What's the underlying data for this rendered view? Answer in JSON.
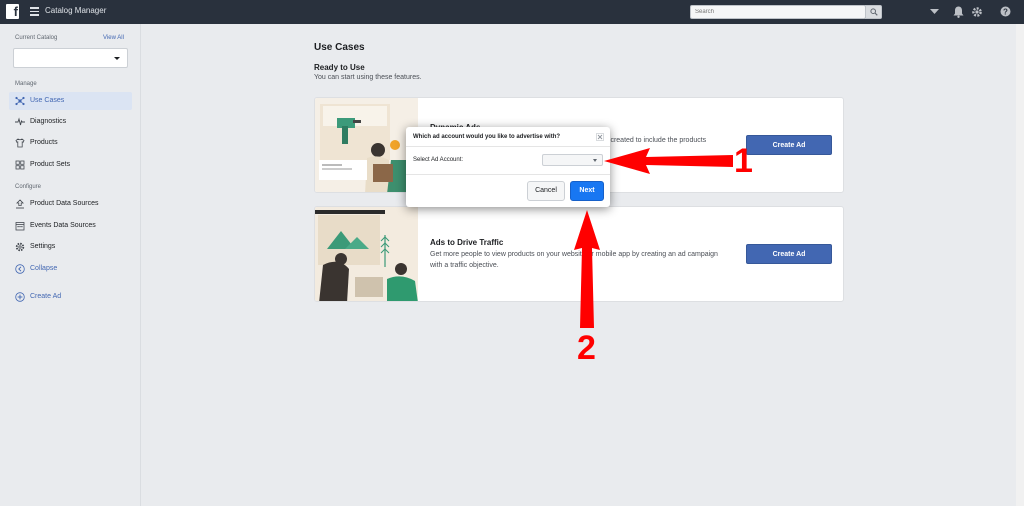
{
  "topbar": {
    "app_title": "Catalog Manager",
    "search_placeholder": "Search"
  },
  "sidebar": {
    "current_catalog_label": "Current Catalog",
    "view_all": "View All",
    "manage_label": "Manage",
    "configure_label": "Configure",
    "manage_items": [
      {
        "label": "Use Cases",
        "icon": "use-cases-icon"
      },
      {
        "label": "Diagnostics",
        "icon": "pulse-icon"
      },
      {
        "label": "Products",
        "icon": "shirt-icon"
      },
      {
        "label": "Product Sets",
        "icon": "grid-icon"
      }
    ],
    "configure_items": [
      {
        "label": "Product Data Sources",
        "icon": "upload-icon"
      },
      {
        "label": "Events Data Sources",
        "icon": "calendar-icon"
      },
      {
        "label": "Settings",
        "icon": "gear-icon"
      },
      {
        "label": "Collapse",
        "icon": "chevron-left-icon"
      }
    ],
    "create_ad": "Create Ad"
  },
  "main": {
    "title": "Use Cases",
    "ready_title": "Ready to Use",
    "ready_subtitle": "You can start using these features.",
    "cards": [
      {
        "title": "Dynamic Ads",
        "description": "ally created to include the products",
        "button": "Create Ad"
      },
      {
        "title": "Ads to Drive Traffic",
        "description": "Get more people to view products on your website or mobile app by creating an ad campaign with a traffic objective.",
        "button": "Create Ad"
      }
    ]
  },
  "modal": {
    "title": "Which ad account would you like to advertise with?",
    "select_label": "Select Ad Account:",
    "select_value": "",
    "cancel": "Cancel",
    "next": "Next"
  },
  "annotations": {
    "step_1": "1",
    "step_2": "2",
    "color": "#ff0000"
  },
  "colors": {
    "topbar": "#29313d",
    "accent": "#4267b2",
    "next_button": "#1877f2"
  }
}
